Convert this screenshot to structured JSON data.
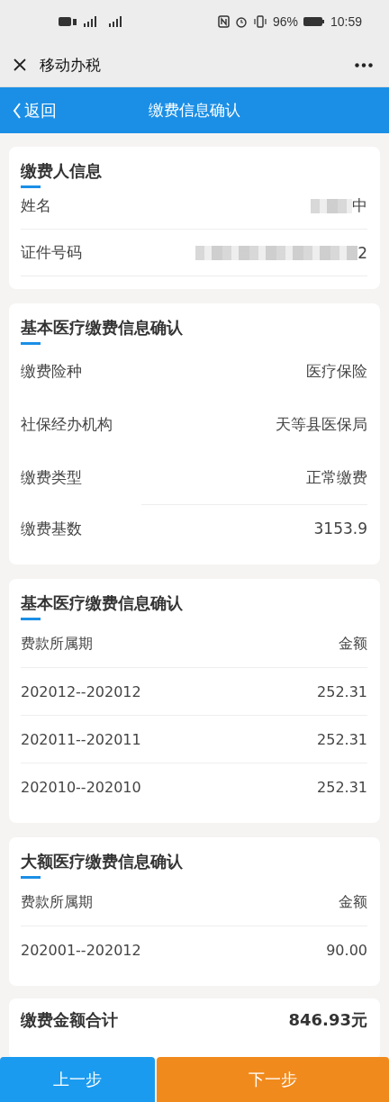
{
  "status_bar": {
    "battery": "96%",
    "time": "10:59"
  },
  "app_bar": {
    "title": "移动办税"
  },
  "header": {
    "back": "返回",
    "title": "缴费信息确认"
  },
  "cards": [
    {
      "kind": "list",
      "title": "缴费人信息",
      "rows": [
        {
          "label": "姓名",
          "value": "中",
          "redacted": true
        },
        {
          "label": "证件号码",
          "value": "2",
          "redacted": true
        }
      ]
    },
    {
      "kind": "plain",
      "title": "基本医疗缴费信息确认",
      "rows": [
        {
          "label": "缴费险种",
          "value": "医疗保险"
        },
        {
          "label": "社保经办机构",
          "value": "天等县医保局"
        },
        {
          "label": "缴费类型",
          "value": "正常缴费"
        },
        {
          "label": "缴费基数",
          "value": "3153.9"
        }
      ]
    },
    {
      "kind": "table",
      "title": "基本医疗缴费信息确认",
      "rows": [
        {
          "label": "费款所属期",
          "value": "金额"
        },
        {
          "label": "202012--202012",
          "value": "252.31"
        },
        {
          "label": "202011--202011",
          "value": "252.31"
        },
        {
          "label": "202010--202010",
          "value": "252.31"
        }
      ]
    },
    {
      "kind": "table",
      "title": "大额医疗缴费信息确认",
      "rows": [
        {
          "label": "费款所属期",
          "value": "金额"
        },
        {
          "label": "202001--202012",
          "value": "90.00"
        }
      ]
    }
  ],
  "total": {
    "label": "缴费金额合计",
    "value": "846.93元"
  },
  "buttons": [
    {
      "label": "上一步",
      "kind": "secondary"
    },
    {
      "label": "下一步",
      "kind": "primary"
    }
  ]
}
